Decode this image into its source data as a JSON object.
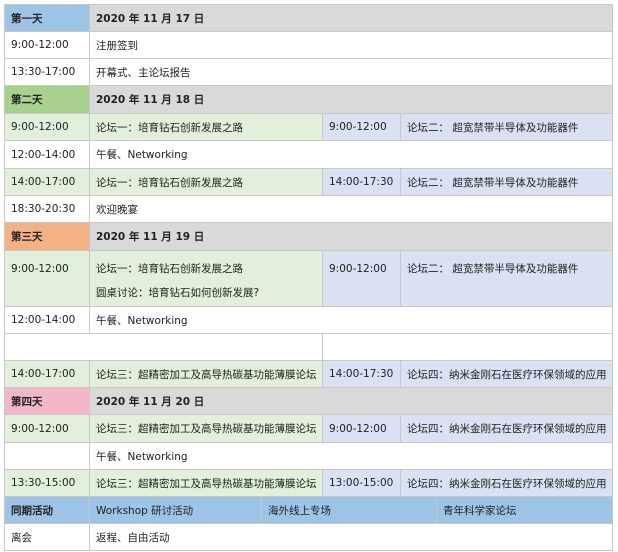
{
  "day1": {
    "label": "第一天",
    "date": "2020 年 11 月 17 日",
    "rows": [
      {
        "time": "9:00-12:00",
        "event": "注册签到"
      },
      {
        "time": "13:30-17:00",
        "event": "开幕式、主论坛报告"
      }
    ]
  },
  "day2": {
    "label": "第二天",
    "date": "2020 年 11 月 18 日",
    "rows": [
      {
        "time": "9:00-12:00",
        "event": "论坛一：培育钻石创新发展之路",
        "time2": "9:00-12:00",
        "event2": "论坛二： 超宽禁带半导体及功能器件"
      },
      {
        "time": "12:00-14:00",
        "event": "午餐、Networking"
      },
      {
        "time": "14:00-17:00",
        "event": "论坛一：培育钻石创新发展之路",
        "time2": "14:00-17:30",
        "event2": "论坛二： 超宽禁带半导体及功能器件"
      },
      {
        "time": "18:30-20:30",
        "event": "欢迎晚宴"
      }
    ]
  },
  "day3": {
    "label": "第三天",
    "date": "2020 年 11 月 19 日",
    "rows": [
      {
        "time": "9:00-12:00",
        "event": "论坛一：培育钻石创新发展之路",
        "event_b": "圆桌讨论：培育钻石如何创新发展?",
        "time2": "9:00-12:00",
        "event2": "论坛二： 超宽禁带半导体及功能器件"
      },
      {
        "time": "12:00-14:00",
        "event": "午餐、Networking"
      },
      {
        "time": "14:00-17:00",
        "event": "论坛三：超精密加工及高导热碳基功能薄膜论坛",
        "time2": "14:00-17:30",
        "event2": "论坛四：纳米金刚石在医疗环保领域的应用"
      }
    ]
  },
  "day4": {
    "label": "第四天",
    "date": "2020 年 11 月 20 日",
    "rows": [
      {
        "time": "9:00-12:00",
        "event": "论坛三：超精密加工及高导热碳基功能薄膜论坛",
        "time2": "9:00-12:00",
        "event2": "论坛四：纳米金刚石在医疗环保领域的应用"
      },
      {
        "time": "",
        "event": "午餐、Networking"
      },
      {
        "time": "13:30-15:00",
        "event": "论坛三：超精密加工及高导热碳基功能薄膜论坛",
        "time2": "13:00-15:00",
        "event2": "论坛四：纳米金刚石在医疗环保领域的应用"
      }
    ]
  },
  "concurrent": {
    "label": "同期活动",
    "items": [
      "Workshop 研讨活动",
      "海外线上专场",
      "青年科学家论坛"
    ]
  },
  "departure": {
    "label": "离会",
    "event": "返程、自由活动"
  },
  "colors": {
    "day1": "#9dc3e6",
    "day2": "#a9d18e",
    "day3": "#f4b183",
    "day4": "#f4b6c9",
    "forum_green": "#e2efda",
    "forum_blue": "#d9e1f2",
    "header_gray": "#d9d9d9"
  }
}
